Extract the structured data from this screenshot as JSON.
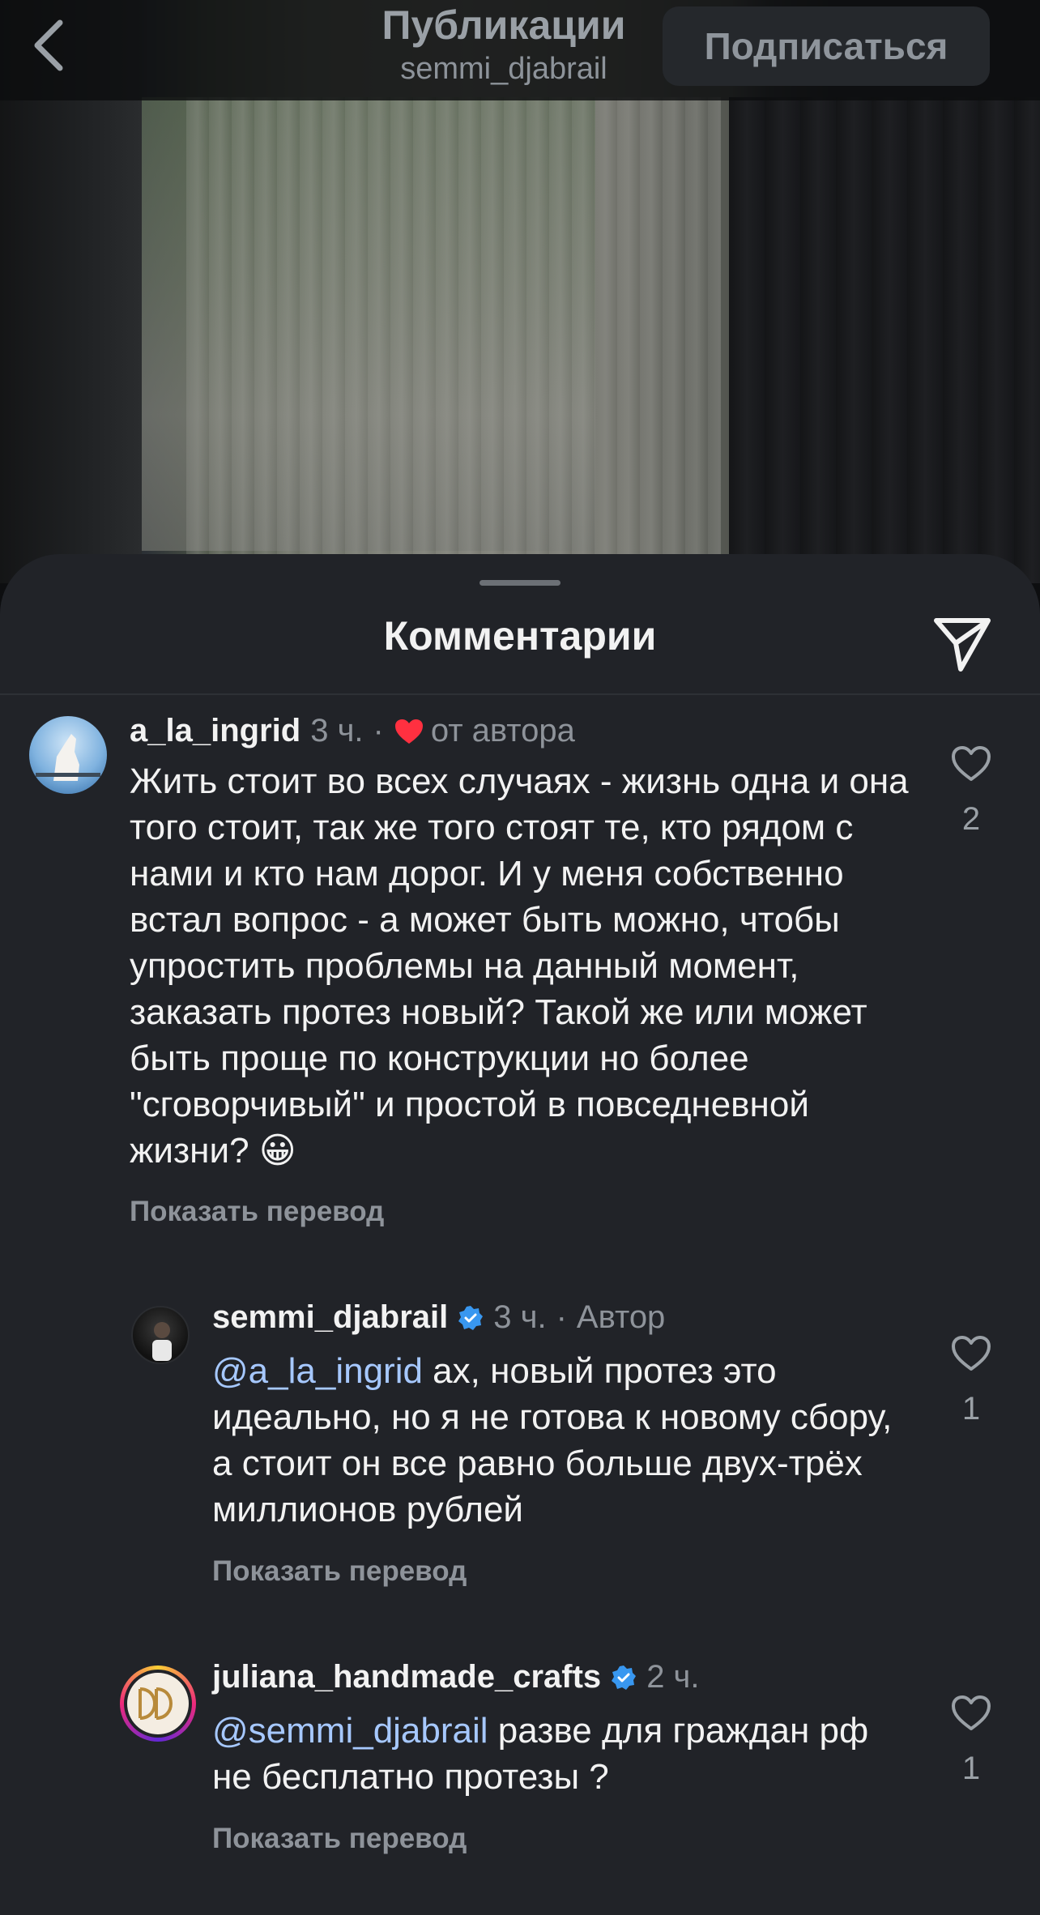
{
  "nav": {
    "title": "Публикации",
    "subtitle": "semmi_djabrail",
    "follow_label": "Подписаться"
  },
  "sheet": {
    "title": "Комментарии"
  },
  "comments": [
    {
      "username": "a_la_ingrid",
      "time": "3 ч.",
      "separator": "·",
      "liked_by_author_label": "от автора",
      "text": "Жить стоит во всех случаях - жизнь одна и она того стоит, так же того стоят те, кто рядом с нами и кто нам дорог. И у меня собственно встал вопрос - а может быть можно, чтобы упростить проблемы на данный момент, заказать протез новый? Такой же или может быть проще по конструкции но более \"сговорчивый\" и простой в повседневной жизни? 😀",
      "translate_label": "Показать перевод",
      "likes": "2"
    },
    {
      "username": "semmi_djabrail",
      "verified": true,
      "time": "3 ч.",
      "separator": "·",
      "role": "Автор",
      "mention": "@a_la_ingrid",
      "text": " ах, новый протез это идеально, но я не готова к новому сбору, а стоит он все равно больше двух-трёх миллионов рублей",
      "translate_label": "Показать перевод",
      "likes": "1"
    },
    {
      "username": "juliana_handmade_crafts",
      "verified": true,
      "time": "2 ч.",
      "mention": "@semmi_djabrail",
      "text": " разве для граждан рф не бесплатно протезы ?",
      "translate_label": "Показать перевод",
      "likes": "1"
    }
  ],
  "colors": {
    "sheet_bg": "#212328",
    "mention": "#a6c8ff",
    "heart_red": "#ff3040",
    "verified_blue": "#3897f0"
  },
  "icons": {
    "back": "chevron-left-icon",
    "share": "paper-plane-icon",
    "like": "heart-outline-icon",
    "author_like": "heart-filled-icon",
    "verified": "verified-badge-icon"
  }
}
